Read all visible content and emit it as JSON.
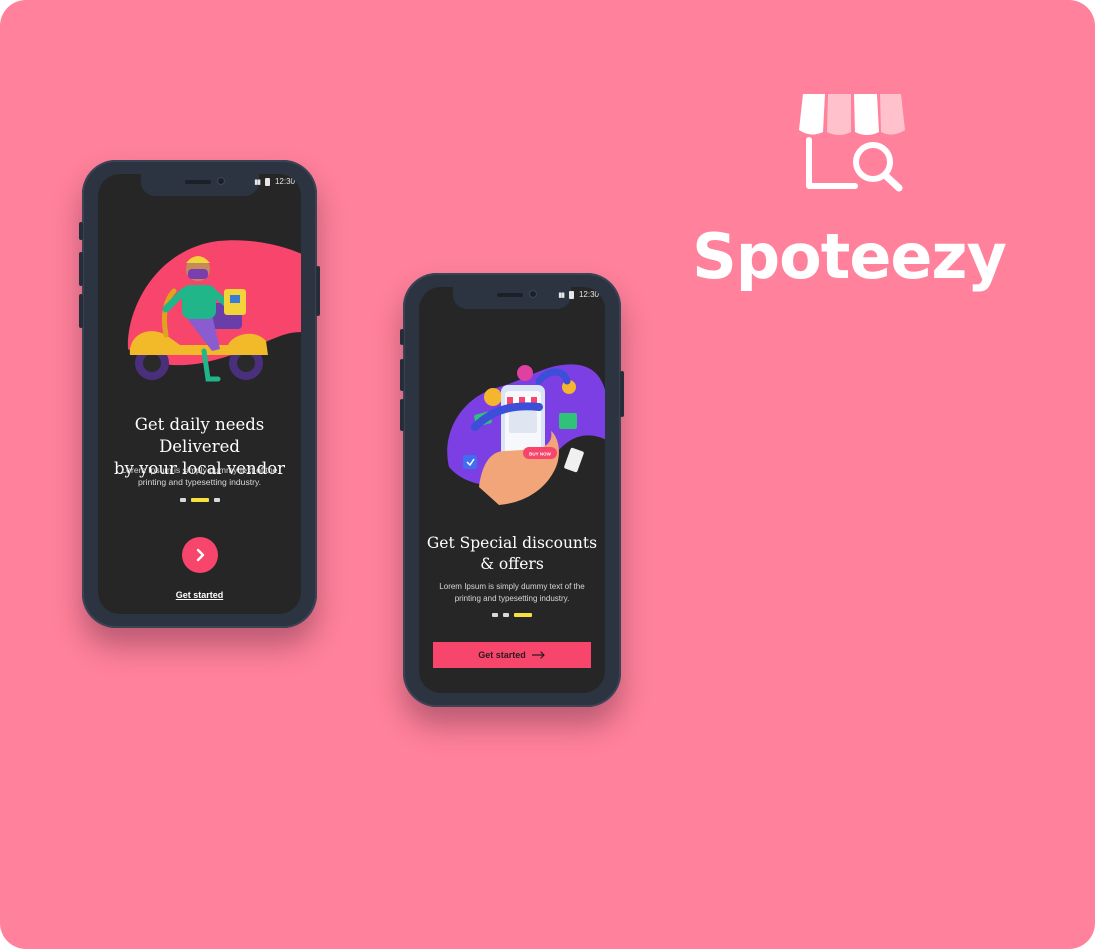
{
  "brand": {
    "name": "Spoteezy",
    "logo_icon": "shop-search-icon",
    "colors": {
      "background": "#ff819b",
      "accent": "#f8456b",
      "indicator": "#f7e23d",
      "phone_frame": "#2c3442",
      "screen": "#262626"
    }
  },
  "phones": [
    {
      "status_time": "12:30",
      "headline_line1": "Get daily needs Delivered",
      "headline_line2": "by your local vendor",
      "body_line1": "Lorem Ipsum is simply dummy text of the",
      "body_line2": "printing and typesetting industry.",
      "illustration": "delivery-scooter-illustration",
      "next_icon": "chevron-right-icon",
      "link_label": "Get started",
      "active_dot": 1
    },
    {
      "status_time": "12:30",
      "headline_line1": "Get Special discounts",
      "headline_line2": "& offers",
      "body_line1": "Lorem Ipsum is simply dummy text of the",
      "body_line2": "printing and typesetting industry.",
      "illustration": "shopping-phone-illustration",
      "illustration_badge": "BUY NOW",
      "cta_label": "Get started",
      "cta_icon": "arrow-right-icon",
      "active_dot": 2
    }
  ]
}
